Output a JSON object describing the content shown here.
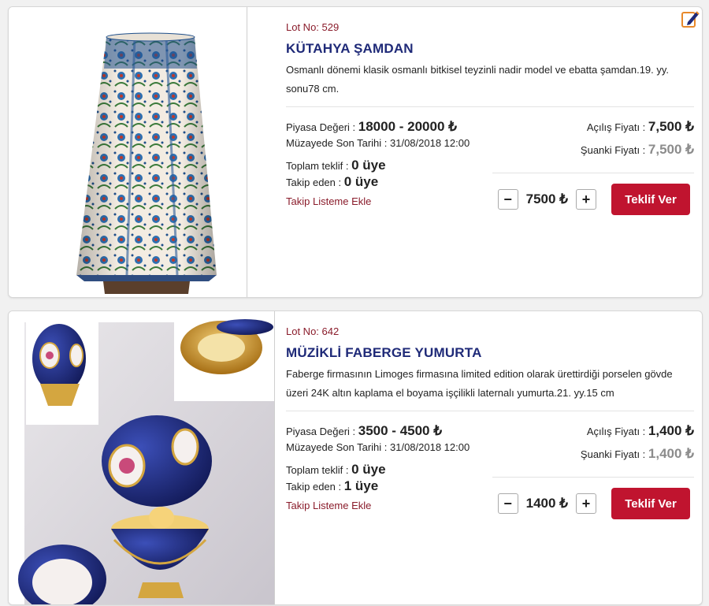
{
  "lots": [
    {
      "lot_label": "Lot No: 529",
      "title": "KÜTAHYA ŞAMDAN",
      "description": "Osmanlı dönemi klasik osmanlı bitkisel teyzinli nadir model ve ebatta şamdan.19. yy. sonu78 cm.",
      "market_label": "Piyasa Değeri : ",
      "market_value": "18000 - 20000 ₺",
      "deadline": "Müzayede Son Tarihi : 31/08/2018 12:00",
      "total_label": "Toplam teklif : ",
      "total_value": "0 üye",
      "followers_label": "Takip eden : ",
      "followers_value": "0 üye",
      "follow_link": "Takip Listeme Ekle",
      "opening_label": "Açılış Fiyatı : ",
      "opening_value": "7,500 ₺",
      "current_label": "Şuanki Fiyatı : ",
      "current_value": "7,500 ₺",
      "minus": "−",
      "bid_amount": "7500 ₺",
      "plus": "+",
      "bid_button": "Teklif Ver"
    },
    {
      "lot_label": "Lot No: 642",
      "title": "MÜZİKLİ FABERGE YUMURTA",
      "description": "Faberge firmasının Limoges firmasına limited edition olarak ürettirdiği porselen gövde üzeri 24K altın kaplama el boyama işçilikli laternalı yumurta.21. yy.15 cm",
      "market_label": "Piyasa Değeri : ",
      "market_value": "3500 - 4500 ₺",
      "deadline": "Müzayede Son Tarihi : 31/08/2018 12:00",
      "total_label": "Toplam teklif : ",
      "total_value": "0 üye",
      "followers_label": "Takip eden : ",
      "followers_value": "1 üye",
      "follow_link": "Takip Listeme Ekle",
      "opening_label": "Açılış Fiyatı : ",
      "opening_value": "1,400 ₺",
      "current_label": "Şuanki Fiyatı : ",
      "current_value": "1,400 ₺",
      "minus": "−",
      "bid_amount": "1400 ₺",
      "plus": "+",
      "bid_button": "Teklif Ver"
    }
  ],
  "icons": {
    "edit": "edit-note-icon"
  },
  "colors": {
    "title": "#1f2a78",
    "lot_label": "#8a1c2b",
    "bid_button": "#c0142f",
    "edit_icon": "#e8892b"
  }
}
